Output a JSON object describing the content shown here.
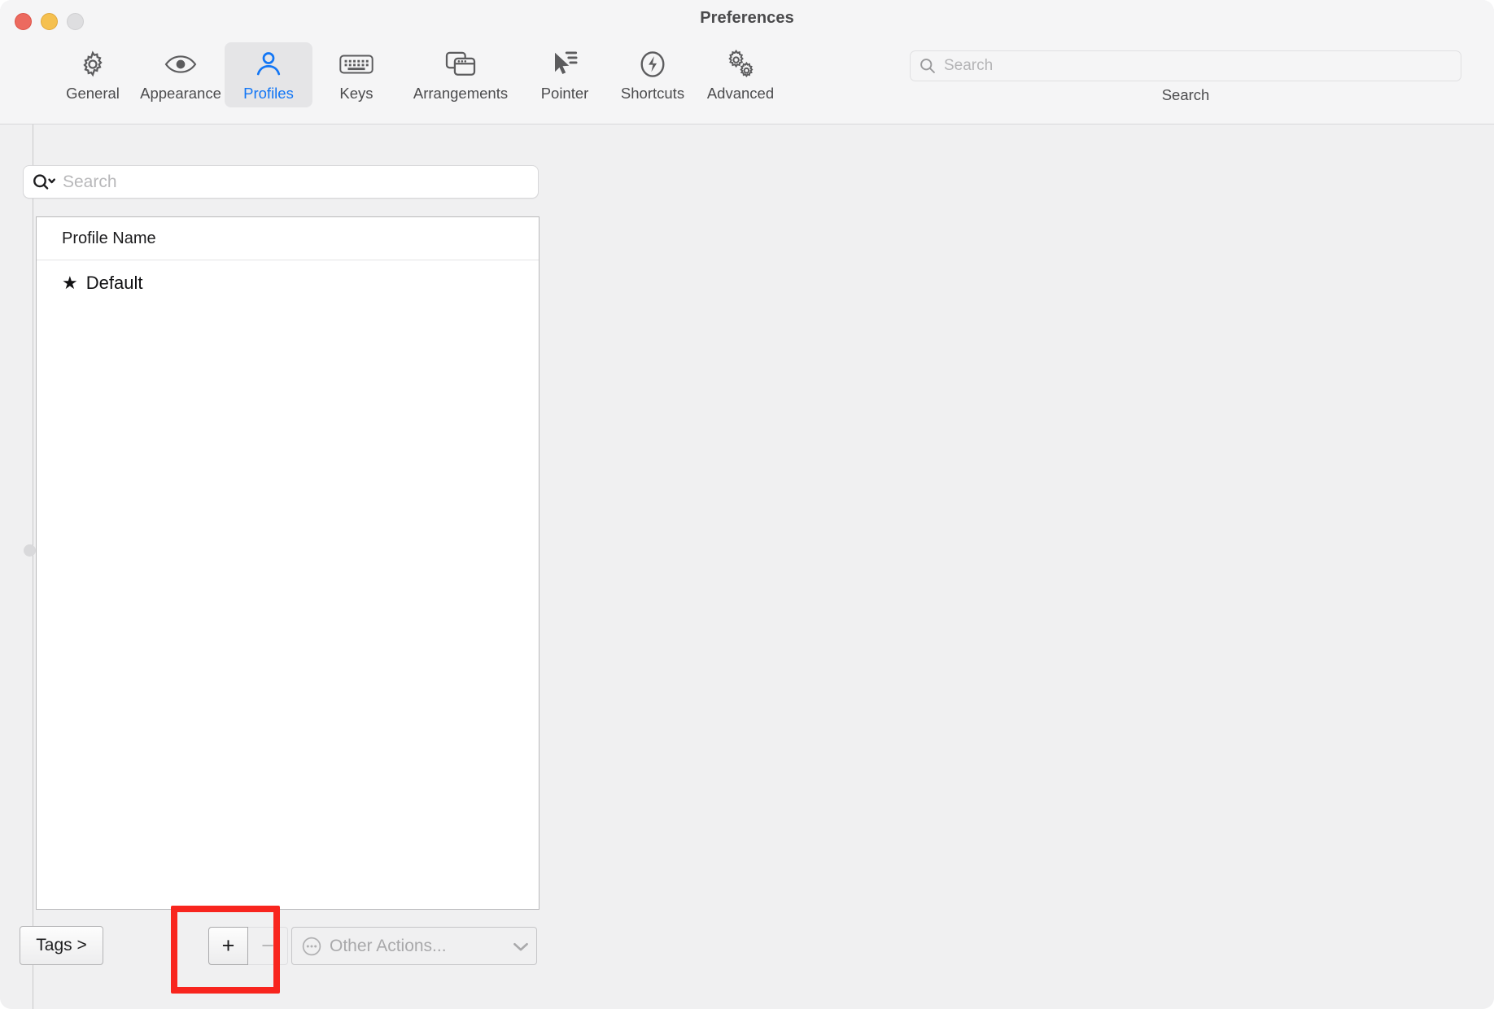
{
  "window": {
    "title": "Preferences",
    "traffic_lights": [
      {
        "name": "close",
        "color": "#ec6a5f"
      },
      {
        "name": "minimize",
        "color": "#f5c04f"
      },
      {
        "name": "zoom",
        "color": "#dedee0"
      }
    ]
  },
  "toolbar": {
    "items": [
      {
        "label": "General",
        "icon": "gear-icon",
        "selected": false
      },
      {
        "label": "Appearance",
        "icon": "eye-icon",
        "selected": false
      },
      {
        "label": "Profiles",
        "icon": "person-icon",
        "selected": true
      },
      {
        "label": "Keys",
        "icon": "keyboard-icon",
        "selected": false
      },
      {
        "label": "Arrangements",
        "icon": "windows-icon",
        "selected": false
      },
      {
        "label": "Pointer",
        "icon": "cursor-icon",
        "selected": false
      },
      {
        "label": "Shortcuts",
        "icon": "bolt-circle-icon",
        "selected": false
      },
      {
        "label": "Advanced",
        "icon": "double-gear-icon",
        "selected": false
      }
    ],
    "search": {
      "placeholder": "Search",
      "value": "",
      "caption": "Search"
    },
    "selected_accent": "#1276f5"
  },
  "sidebar": {
    "search": {
      "placeholder": "Search",
      "value": ""
    },
    "list": {
      "column_header": "Profile Name",
      "rows": [
        {
          "star": "★",
          "name": "Default"
        }
      ]
    },
    "bottom_bar": {
      "tags_label": "Tags >",
      "add_label": "+",
      "remove_label": "−",
      "other_actions_label": "Other Actions..."
    }
  },
  "annotation": {
    "color": "#f8251e",
    "target": "add-profile-button"
  }
}
